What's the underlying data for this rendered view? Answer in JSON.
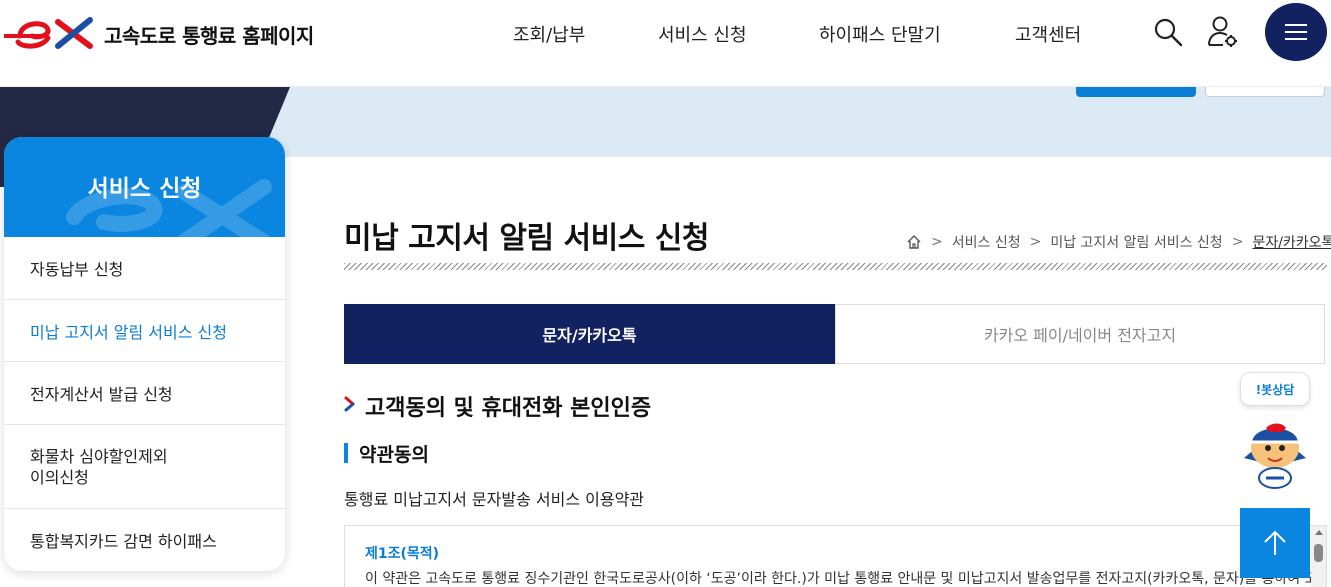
{
  "header": {
    "site_title": "고속도로 통행료 홈페이지",
    "nav": [
      "조회/납부",
      "서비스 신청",
      "하이패스 단말기",
      "고객센터"
    ],
    "icons": {
      "search": "search-icon",
      "user": "user-login-icon",
      "menu": "hamburger-menu-icon"
    }
  },
  "sidebar": {
    "title": "서비스 신청",
    "items": [
      {
        "label": "자동납부 신청"
      },
      {
        "label": "미납 고지서 알림 서비스 신청",
        "active": true
      },
      {
        "label": "전자계산서 발급 신청"
      },
      {
        "label": "화물차 심야할인제외\n이의신청"
      },
      {
        "label": "통합복지카드 감면 하이패스"
      }
    ]
  },
  "main": {
    "page_title": "미납 고지서 알림 서비스 신청",
    "breadcrumb": [
      "서비스 신청",
      "미납 고지서 알림 서비스 신청",
      "문자/카카오톡"
    ],
    "tabs": [
      {
        "label": "문자/카카오톡",
        "active": true
      },
      {
        "label": "카카오 페이/네이버 전자고지",
        "active": false
      }
    ],
    "section_title": "고객동의 및 휴대전화 본인인증",
    "sub_title": "약관동의",
    "terms_label": "통행료 미납고지서 문자발송 서비스 이용약관",
    "terms": {
      "heading": "제1조(목적)",
      "text": "이 약관은 고속도로 통행료 징수기관인 한국도로공사(이하 ‘도공’이라 한다.)가 미납 통행료 안내문 및 미납고지서 발송업무를 전자고지(카카오톡, 문자)를 통하여 고객"
    }
  },
  "chatbot": {
    "label": "!봇상담"
  },
  "colors": {
    "navy": "#12215f",
    "blue": "#0a86e0",
    "red": "#e3101b"
  }
}
